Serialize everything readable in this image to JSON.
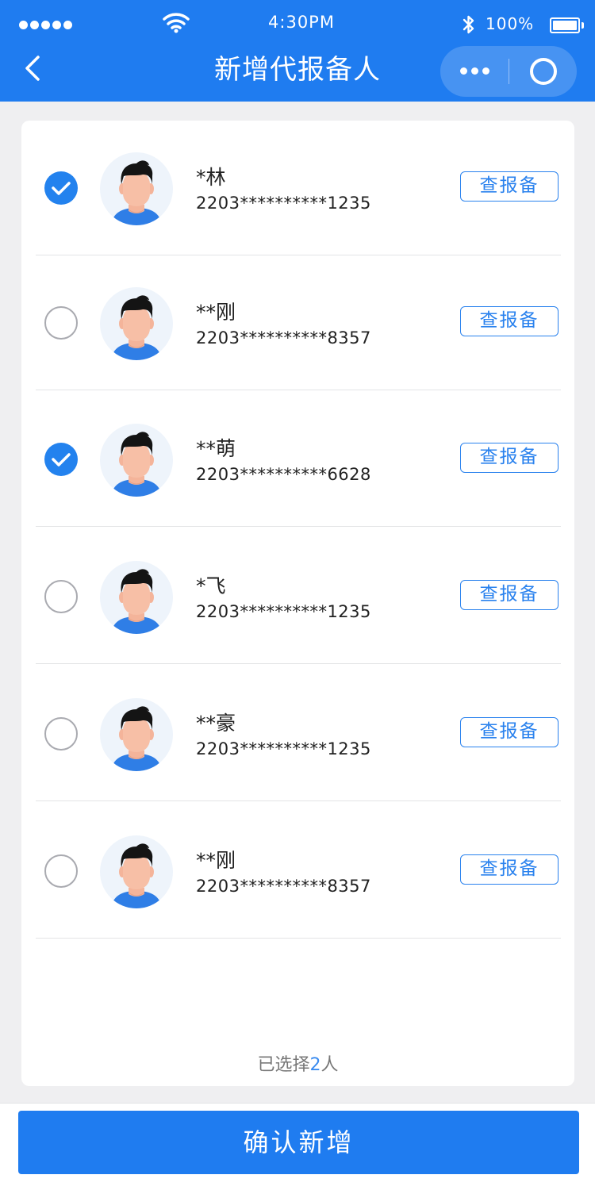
{
  "status_bar": {
    "time": "4:30PM",
    "battery": "100%"
  },
  "nav": {
    "title": "新增代报备人"
  },
  "people": [
    {
      "name": "*林",
      "id": "2203**********1235",
      "checked": true,
      "button": "查报备"
    },
    {
      "name": "**刚",
      "id": "2203**********8357",
      "checked": false,
      "button": "查报备"
    },
    {
      "name": "**萌",
      "id": "2203**********6628",
      "checked": true,
      "button": "查报备"
    },
    {
      "name": "*飞",
      "id": "2203**********1235",
      "checked": false,
      "button": "查报备"
    },
    {
      "name": "**豪",
      "id": "2203**********1235",
      "checked": false,
      "button": "查报备"
    },
    {
      "name": "**刚",
      "id": "2203**********8357",
      "checked": false,
      "button": "查报备"
    }
  ],
  "summary": {
    "prefix": "已选择",
    "count": "2",
    "suffix": "人"
  },
  "confirm_label": "确认新增",
  "colors": {
    "primary": "#1f7cf0",
    "check": "#2382ee"
  }
}
